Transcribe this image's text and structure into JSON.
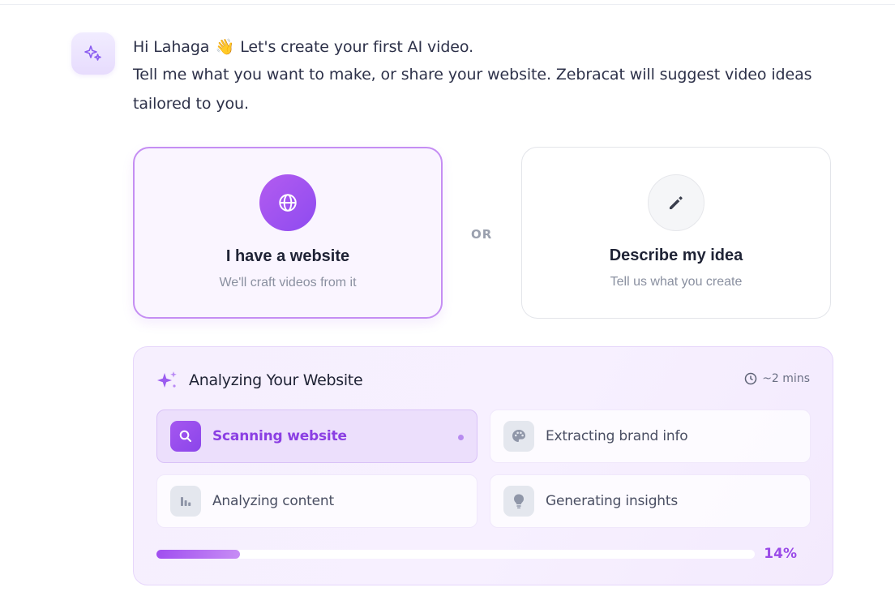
{
  "greeting": {
    "line1_prefix": "Hi Lahaga",
    "wave_emoji": "👋",
    "line1_suffix": "Let's create your first AI video.",
    "line2": "Tell me what you want to make, or share your website. Zebracat will suggest video ideas tailored to you."
  },
  "options": {
    "website": {
      "title": "I have a website",
      "subtitle": "We'll craft videos from it",
      "icon": "globe-icon"
    },
    "separator": "OR",
    "idea": {
      "title": "Describe my idea",
      "subtitle": "Tell us what you create",
      "icon": "pencil-icon"
    }
  },
  "analysis": {
    "title": "Analyzing Your Website",
    "time_estimate": "~2 mins",
    "steps": [
      {
        "label": "Scanning website",
        "icon": "search-icon",
        "active": true
      },
      {
        "label": "Extracting brand info",
        "icon": "palette-icon",
        "active": false
      },
      {
        "label": "Analyzing content",
        "icon": "bar-chart-icon",
        "active": false
      },
      {
        "label": "Generating insights",
        "icon": "lightbulb-icon",
        "active": false
      }
    ],
    "progress_percent": 14,
    "progress_label": "14%"
  },
  "colors": {
    "accent": "#9a4ae8",
    "accent_border": "#c58ef3",
    "panel_bg": "#f6effe"
  }
}
